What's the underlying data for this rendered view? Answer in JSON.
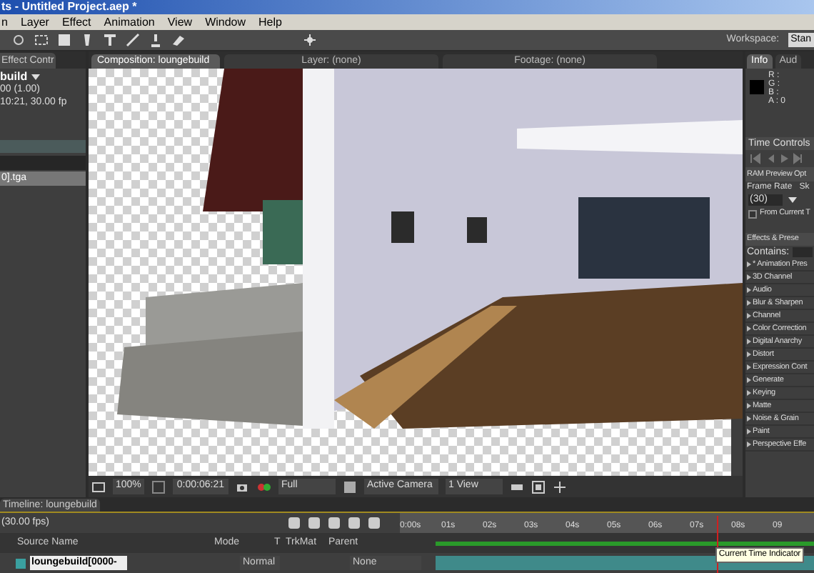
{
  "window": {
    "title": "ts - Untitled Project.aep *"
  },
  "menu": [
    "n",
    "Layer",
    "Effect",
    "Animation",
    "View",
    "Window",
    "Help"
  ],
  "workspace": {
    "label": "Workspace:",
    "value": "Stan"
  },
  "project_panel": {
    "tab": "Effect Contr",
    "comp_name": "build",
    "lines": [
      "00 (1.00)",
      "10:21, 30.00 fp"
    ],
    "items": [
      {
        "name": "0].tga",
        "selected": true
      }
    ]
  },
  "viewer_tabs": [
    {
      "label": "Composition: loungebuild",
      "selected": true
    },
    {
      "label": "Layer: (none)",
      "selected": false
    },
    {
      "label": "Footage: (none)",
      "selected": false
    }
  ],
  "viewer_bar": {
    "zoom": "100%",
    "timecode": "0:00:06:21",
    "resolution": "Full",
    "camera": "Active Camera",
    "views": "1 View"
  },
  "right_tabs": [
    {
      "label": "Info",
      "selected": true
    },
    {
      "label": "Aud",
      "selected": false
    }
  ],
  "info_panel": {
    "channels": [
      "R :",
      "G :",
      "B :",
      "A : 0"
    ]
  },
  "time_controls": {
    "title": "Time Controls",
    "ram_preview": "RAM Preview Opt",
    "frame_rate_label": "Frame Rate",
    "skip_label": "Sk",
    "frame_rate": "(30)",
    "from_current": {
      "label": "From Current T",
      "checked": false
    }
  },
  "effects_panel": {
    "title": "Effects & Prese",
    "contains_label": "Contains:",
    "categories": [
      "* Animation Pres",
      "3D Channel",
      "Audio",
      "Blur & Sharpen",
      "Channel",
      "Color Correction",
      "Digital Anarchy",
      "Distort",
      "Expression Cont",
      "Generate",
      "Keying",
      "Matte",
      "Noise & Grain",
      "Paint",
      "Perspective Effe"
    ]
  },
  "timeline": {
    "tab": "Timeline: loungebuild",
    "fps": "(30.00 fps)",
    "columns": [
      "Source Name",
      "Mode",
      "T",
      "TrkMat",
      "Parent"
    ],
    "layers": [
      {
        "name": "loungebuild[0000-",
        "mode": "Normal",
        "parent": "None"
      }
    ],
    "ruler": [
      "0:00s",
      "01s",
      "02s",
      "03s",
      "04s",
      "05s",
      "06s",
      "07s",
      "08s",
      "09"
    ],
    "time_indicator": {
      "level": 0.745,
      "tooltip": "Current Time Indicator"
    }
  }
}
